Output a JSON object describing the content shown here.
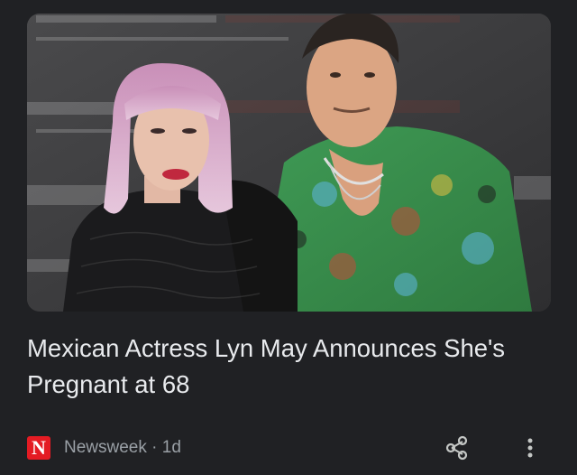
{
  "article": {
    "headline": "Mexican Actress Lyn May Announces She's Pregnant at 68",
    "source_logo_letter": "N",
    "source_name": "Newsweek",
    "separator": "·",
    "age": "1d"
  },
  "colors": {
    "background": "#202124",
    "headline": "#e8eaed",
    "meta": "#9aa0a6",
    "brand": "#e41b23"
  },
  "icons": {
    "share": "share-icon",
    "more": "more-vertical-icon"
  }
}
